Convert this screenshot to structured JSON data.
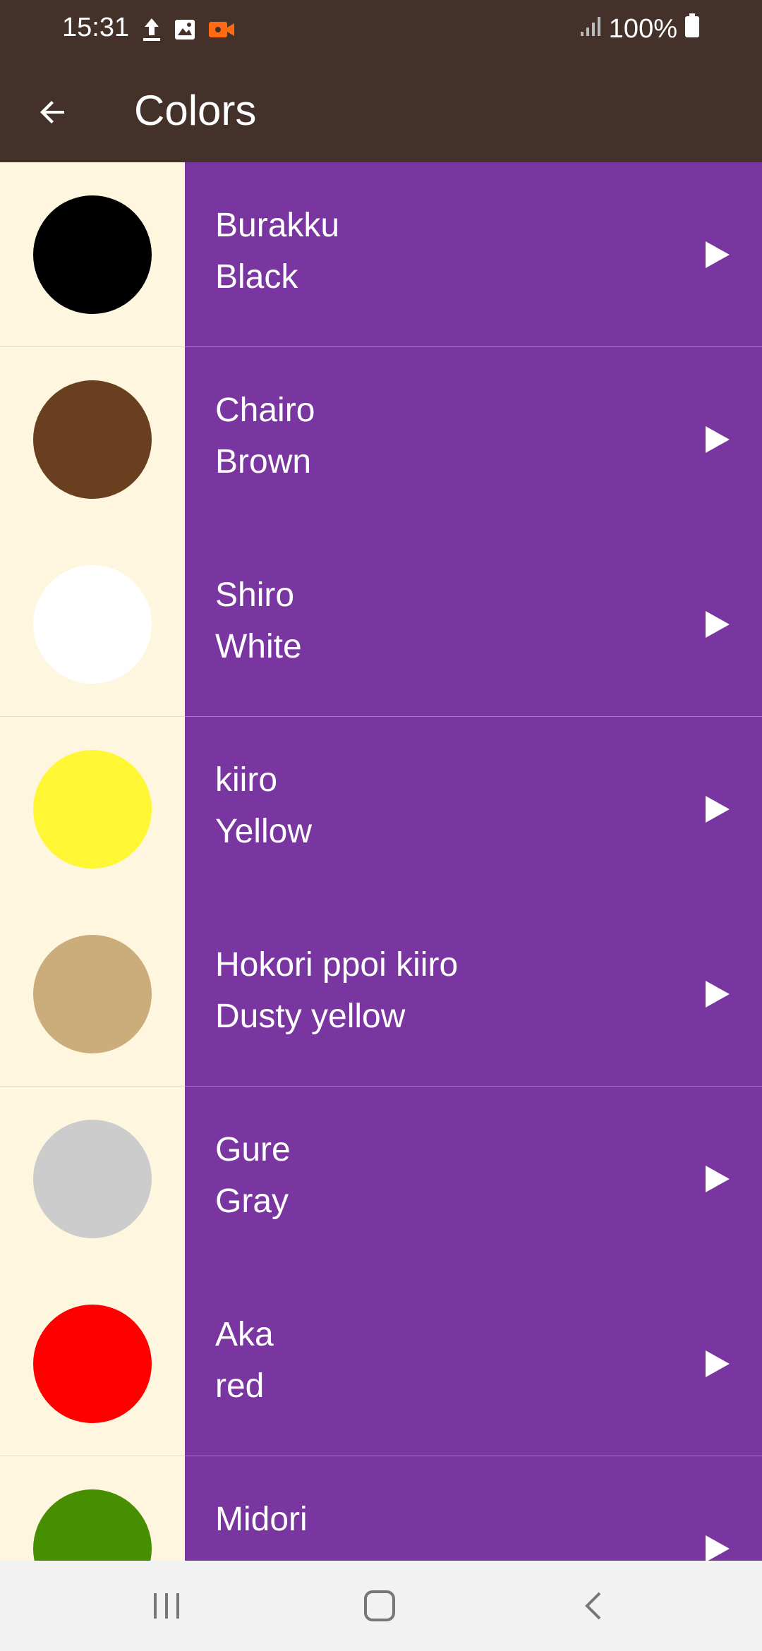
{
  "status_bar": {
    "time": "15:31",
    "battery": "100%"
  },
  "app_bar": {
    "title": "Colors"
  },
  "colors": [
    {
      "romaji": "Burakku",
      "english": "Black",
      "hex": "#000000"
    },
    {
      "romaji": "Chairo",
      "english": "Brown",
      "hex": "#6a3f20"
    },
    {
      "romaji": "Shiro",
      "english": "White",
      "hex": "#ffffff"
    },
    {
      "romaji": "kiiro",
      "english": "Yellow",
      "hex": "#fff733"
    },
    {
      "romaji": "Hokori ppoi kiiro",
      "english": "Dusty yellow",
      "hex": "#cbad7c"
    },
    {
      "romaji": "Gure",
      "english": "Gray",
      "hex": "#cccccc"
    },
    {
      "romaji": "Aka",
      "english": "red",
      "hex": "#ff0000"
    },
    {
      "romaji": "Midori",
      "english": "",
      "hex": "#458f00"
    }
  ],
  "theme": {
    "app_bar": "#44312a",
    "list_text_bg": "#7a36a0",
    "swatch_bg": "#fef6df"
  }
}
